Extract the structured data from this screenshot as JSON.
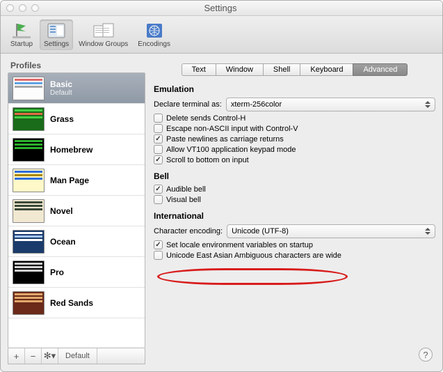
{
  "window": {
    "title": "Settings"
  },
  "toolbar": {
    "startup": "Startup",
    "settings": "Settings",
    "windowgroups": "Window Groups",
    "encodings": "Encodings"
  },
  "sidebar": {
    "header": "Profiles",
    "items": [
      {
        "name": "Basic",
        "sub": "Default",
        "bg": "#fdfdfd",
        "c1": "#e06b6b",
        "c2": "#5ea3e0",
        "c3": "#a8a8a8"
      },
      {
        "name": "Grass",
        "sub": "",
        "bg": "#1a6b1a",
        "c1": "#43d143",
        "c2": "#e06b43",
        "c3": "#43d143"
      },
      {
        "name": "Homebrew",
        "sub": "",
        "bg": "#000000",
        "c1": "#2bb02b",
        "c2": "#2bb02b",
        "c3": "#2bb02b"
      },
      {
        "name": "Man Page",
        "sub": "",
        "bg": "#fff8c8",
        "c1": "#2b6be0",
        "c2": "#aa8800",
        "c3": "#2b6be0"
      },
      {
        "name": "Novel",
        "sub": "",
        "bg": "#f0e8d0",
        "c1": "#3a4a3a",
        "c2": "#3a4a3a",
        "c3": "#3a4a3a"
      },
      {
        "name": "Ocean",
        "sub": "",
        "bg": "#1a3b6b",
        "c1": "#ffffff",
        "c2": "#a8c8ff",
        "c3": "#ffffff"
      },
      {
        "name": "Pro",
        "sub": "",
        "bg": "#000000",
        "c1": "#d0d0d0",
        "c2": "#d0d0d0",
        "c3": "#d0d0d0"
      },
      {
        "name": "Red Sands",
        "sub": "",
        "bg": "#6b2a1a",
        "c1": "#e0a86b",
        "c2": "#e0a86b",
        "c3": "#e0a86b"
      }
    ],
    "footer": {
      "add": "+",
      "remove": "−",
      "gear": "✻▾",
      "default": "Default"
    }
  },
  "tabs": {
    "text": "Text",
    "window": "Window",
    "shell": "Shell",
    "keyboard": "Keyboard",
    "advanced": "Advanced"
  },
  "emulation": {
    "header": "Emulation",
    "declare_label": "Declare terminal as:",
    "declare_value": "xterm-256color",
    "opt_delete": "Delete sends Control-H",
    "opt_escape": "Escape non-ASCII input with Control-V",
    "opt_paste": "Paste newlines as carriage returns",
    "opt_vt100": "Allow VT100 application keypad mode",
    "opt_scroll": "Scroll to bottom on input"
  },
  "bell": {
    "header": "Bell",
    "audible": "Audible bell",
    "visual": "Visual bell"
  },
  "international": {
    "header": "International",
    "encoding_label": "Character encoding:",
    "encoding_value": "Unicode (UTF-8)",
    "opt_locale": "Set locale environment variables on startup",
    "opt_eastasian": "Unicode East Asian Ambiguous characters are wide"
  },
  "help": "?"
}
